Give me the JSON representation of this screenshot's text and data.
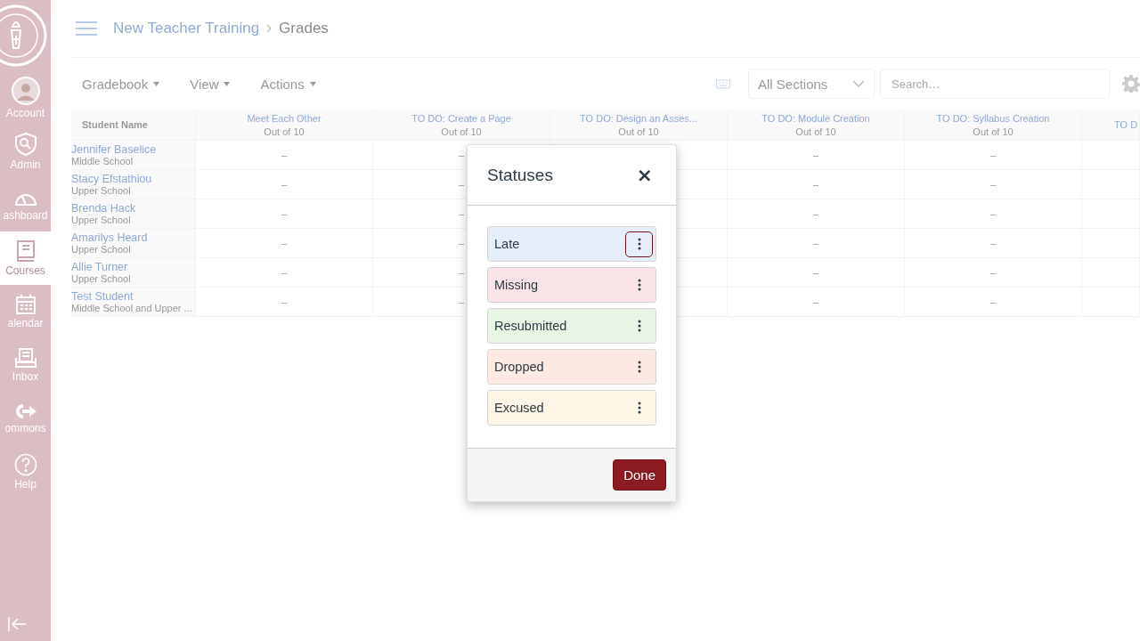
{
  "sidebar": {
    "items": [
      {
        "label": "Account",
        "kind": "avatar",
        "selected": false
      },
      {
        "label": "Admin",
        "kind": "shield",
        "selected": false
      },
      {
        "label": "ashboard",
        "kind": "gauge",
        "selected": false
      },
      {
        "label": "Courses",
        "kind": "book",
        "selected": true
      },
      {
        "label": "alendar",
        "kind": "calendar",
        "selected": false
      },
      {
        "label": "Inbox",
        "kind": "inbox",
        "selected": false
      },
      {
        "label": "ommons",
        "kind": "arrow",
        "selected": false
      },
      {
        "label": "Help",
        "kind": "help",
        "selected": false
      }
    ]
  },
  "breadcrumbs": [
    "New Teacher Training",
    "Grades"
  ],
  "toolbar": {
    "menus": [
      "Gradebook",
      "View",
      "Actions"
    ],
    "section_select": {
      "value": "All Sections"
    },
    "search": {
      "placeholder": "Search…"
    }
  },
  "table": {
    "columns": [
      {
        "title": "Student Name"
      },
      {
        "title": "Meet Each Other",
        "subtitle": "Out of 10",
        "grades": [
          "–",
          "–",
          "–",
          "–",
          "–",
          "–"
        ]
      },
      {
        "title": "TO DO: Create a Page",
        "subtitle": "Out of 10",
        "grades": [
          "–",
          "–",
          "–",
          "–",
          "–",
          "–"
        ]
      },
      {
        "title": "TO DO: Design an Asses...",
        "subtitle": "Out of 10"
      },
      {
        "title": "TO DO: Module Creation",
        "subtitle": "Out of 10",
        "grades": [
          "–",
          "–",
          "–",
          "–",
          "–",
          "–"
        ]
      },
      {
        "title": "TO DO: Syllabus Creation",
        "subtitle": "Out of 10",
        "grades": [
          "–",
          "–",
          "–",
          "–",
          "–",
          "–"
        ]
      },
      {
        "title": "TO D"
      }
    ],
    "rows": [
      {
        "name": "Jennifer Baselice",
        "section": "Middle School"
      },
      {
        "name": "Stacy Efstathiou",
        "section": "Upper School"
      },
      {
        "name": "Brenda Hack",
        "section": "Upper School"
      },
      {
        "name": "Amarilys Heard",
        "section": "Upper School"
      },
      {
        "name": "Allie Turner",
        "section": "Upper School"
      },
      {
        "name": "Test Student",
        "section": "Middle School and Upper ..."
      }
    ]
  },
  "modal": {
    "title": "Statuses",
    "close": "×",
    "statuses": [
      {
        "label": "Late",
        "color": "#e5eef8",
        "focused": true
      },
      {
        "label": "Missing",
        "color": "#f9e3e6",
        "focused": false
      },
      {
        "label": "Resubmitted",
        "color": "#e8f5e5",
        "focused": false
      },
      {
        "label": "Dropped",
        "color": "#fbe9e2",
        "focused": false
      },
      {
        "label": "Excused",
        "color": "#fdf5e5",
        "focused": false
      }
    ],
    "done": "Done"
  }
}
